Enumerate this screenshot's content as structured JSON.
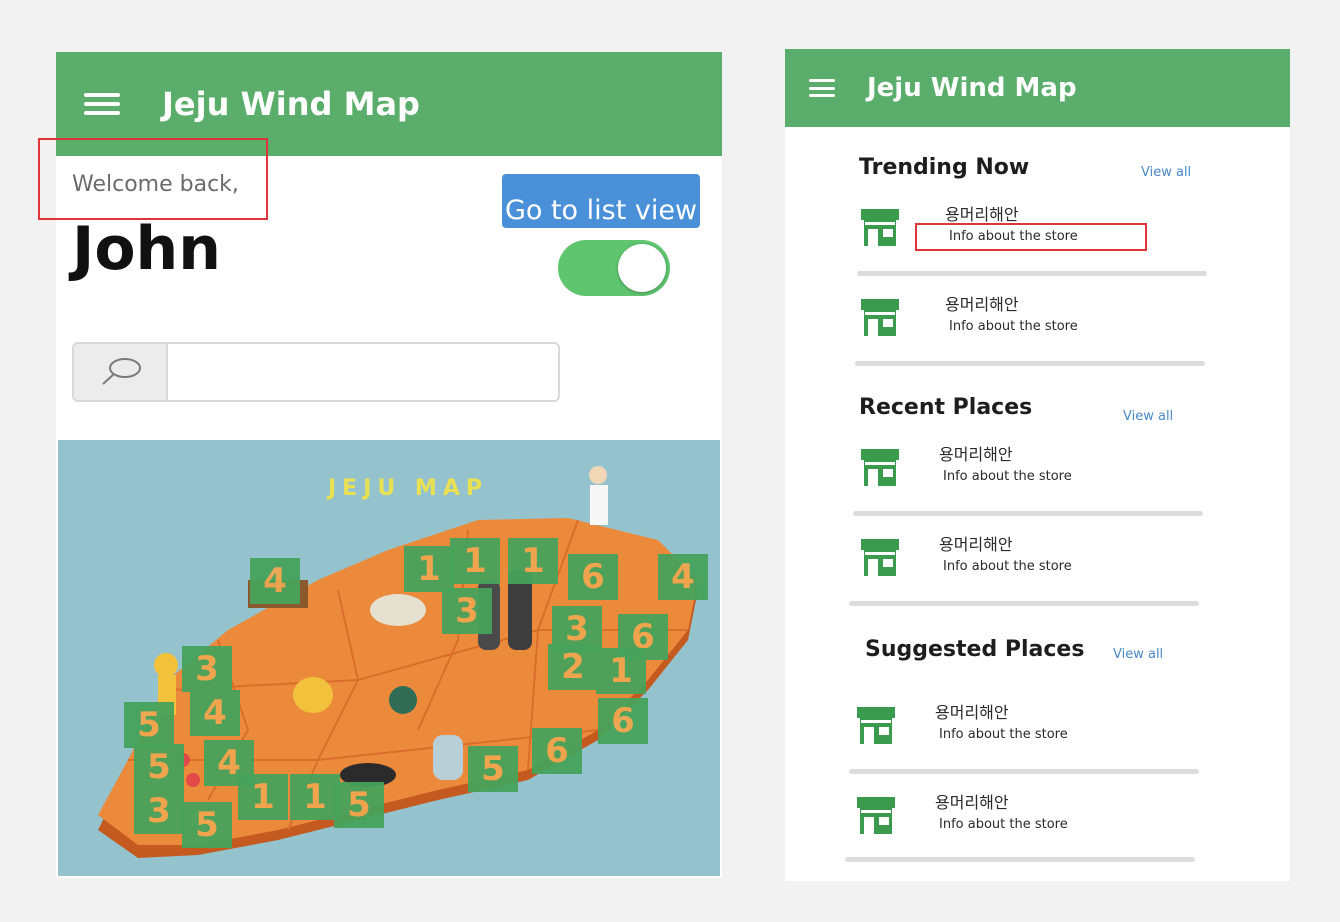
{
  "left_screen": {
    "app_title": "Jeju Wind Map",
    "greeting": "Welcome back,",
    "user_name": "John",
    "list_button_label": "Go to list view",
    "toggle_on": true,
    "search_placeholder": "",
    "map": {
      "title": "JEJU MAP",
      "markers": [
        "4",
        "1",
        "1",
        "1",
        "6",
        "4",
        "3",
        "3",
        "6",
        "2",
        "1",
        "3",
        "4",
        "5",
        "5",
        "4",
        "6",
        "6",
        "5",
        "1",
        "1",
        "5",
        "3",
        "5"
      ]
    }
  },
  "right_screen": {
    "app_title": "Jeju Wind Map",
    "sections": [
      {
        "title": "Trending Now",
        "view_all": "View all",
        "items": [
          {
            "name": "용머리해안",
            "info": "Info about the store"
          },
          {
            "name": "용머리해안",
            "info": "Info about the store"
          }
        ]
      },
      {
        "title": "Recent Places",
        "view_all": "View all",
        "items": [
          {
            "name": "용머리해안",
            "info": "Info about the store"
          },
          {
            "name": "용머리해안",
            "info": "Info about the store"
          }
        ]
      },
      {
        "title": "Suggested Places",
        "view_all": "View all",
        "items": [
          {
            "name": "용머리해안",
            "info": "Info about the store"
          },
          {
            "name": "용머리해안",
            "info": "Info about the store"
          }
        ]
      }
    ]
  },
  "colors": {
    "app_bar": "#5aad6a",
    "button_blue": "#4a90d9",
    "toggle_green": "#5fc56f",
    "highlight_red": "#e0343a",
    "map_sea": "#95c3cd",
    "map_land": "#ec8a3c",
    "marker_green": "#47a35c",
    "store_icon_green": "#3a9a4e",
    "link_blue": "#4a88c9"
  },
  "icons": [
    "menu-icon",
    "search-icon",
    "store-icon"
  ]
}
